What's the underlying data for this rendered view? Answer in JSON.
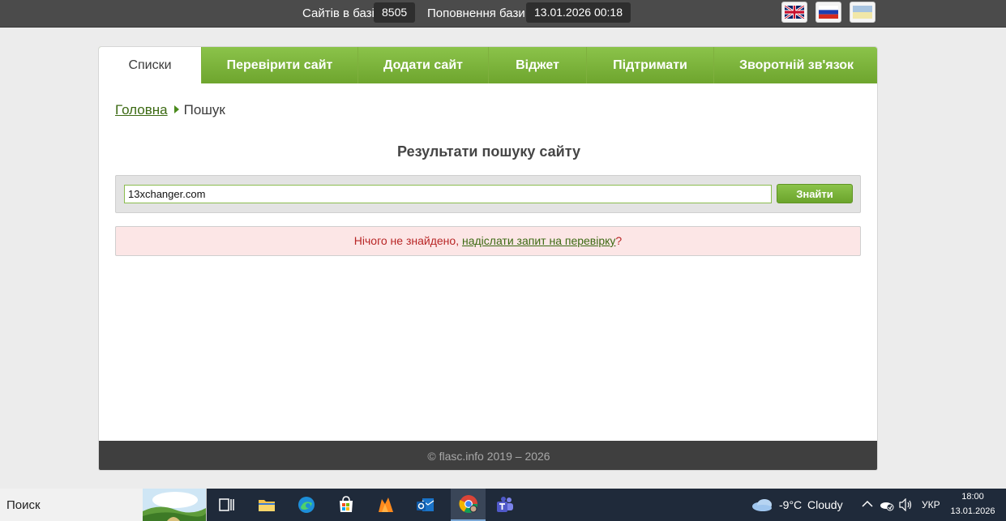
{
  "topbar": {
    "sites_label": "Сайтів в базі",
    "sites_count": "8505",
    "update_label": "Поповнення бази",
    "update_date": "13.01.2026 00:18",
    "languages": [
      "en",
      "ru",
      "uk"
    ]
  },
  "nav": {
    "tabs": [
      {
        "label": "Списки"
      },
      {
        "label": "Перевірити сайт"
      },
      {
        "label": "Додати сайт"
      },
      {
        "label": "Віджет"
      },
      {
        "label": "Підтримати"
      },
      {
        "label": "Зворотній зв'язок"
      }
    ]
  },
  "breadcrumb": {
    "home": "Головна",
    "current": "Пошук"
  },
  "page": {
    "title": "Результати пошуку сайту"
  },
  "search": {
    "value": "13xchanger.com",
    "button": "Знайти"
  },
  "alert": {
    "prefix": "Нічого не знайдено, ",
    "link": "надіслати запит на перевірку",
    "suffix": "?"
  },
  "footer": {
    "copyright": "© flasc.info 2019 – 2026"
  },
  "taskbar": {
    "search_label": "Поиск",
    "apps": [
      "task-view",
      "file-explorer",
      "edge",
      "store",
      "firefox",
      "outlook",
      "chrome",
      "teams"
    ],
    "active_app": "chrome",
    "weather": {
      "temp": "-9°C",
      "condition": "Cloudy"
    },
    "language": "УКР",
    "time": "18:00",
    "date": "13.01.2026"
  },
  "colors": {
    "accent_green": "#7cb83a",
    "link_green": "#3c6a13",
    "alert_text": "#b82626",
    "alert_bg": "#fce6e6"
  }
}
